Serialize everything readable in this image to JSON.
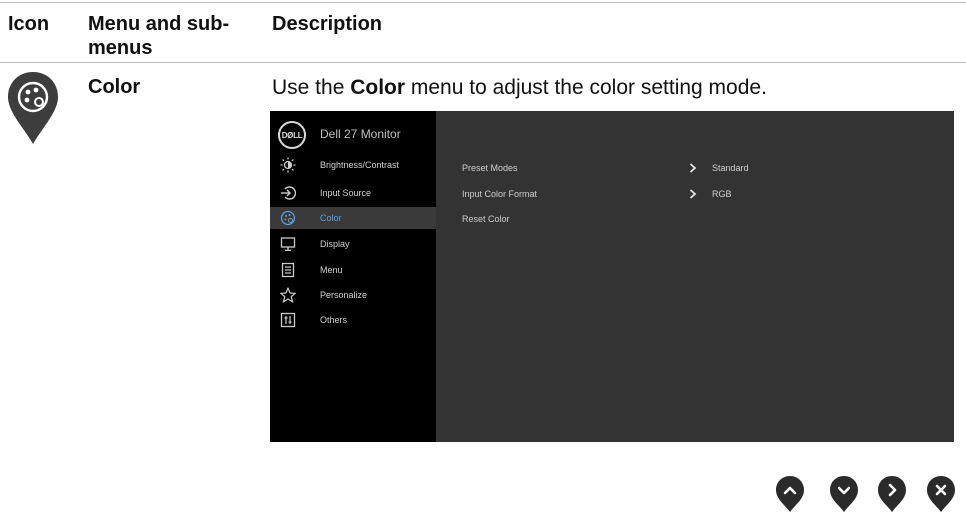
{
  "table_header": {
    "icon": "Icon",
    "menu": "Menu and sub-menus",
    "description": "Description"
  },
  "row": {
    "icon": "color-palette-icon",
    "name": "Color",
    "description_prefix": "Use the ",
    "description_bold": "Color",
    "description_suffix": " menu to adjust the color setting mode."
  },
  "osd": {
    "brand": "DØLL",
    "model": "Dell 27 Monitor",
    "menu": [
      {
        "label": "Brightness/Contrast",
        "icon": "brightness-icon"
      },
      {
        "label": "Input Source",
        "icon": "input-source-icon"
      },
      {
        "label": "Color",
        "icon": "color-icon",
        "active": true
      },
      {
        "label": "Display",
        "icon": "display-icon"
      },
      {
        "label": "Menu",
        "icon": "menu-icon"
      },
      {
        "label": "Personalize",
        "icon": "star-icon"
      },
      {
        "label": "Others",
        "icon": "others-icon"
      }
    ],
    "options": [
      {
        "label": "Preset Modes",
        "value": "Standard"
      },
      {
        "label": "Input Color Format",
        "value": "RGB"
      },
      {
        "label": "Reset Color",
        "value": ""
      }
    ],
    "colors": {
      "accent": "#5aa0dc",
      "panel": "#333333",
      "sidebar": "#000000"
    }
  },
  "nav_buttons": [
    "up-icon",
    "down-icon",
    "right-icon",
    "close-icon"
  ]
}
